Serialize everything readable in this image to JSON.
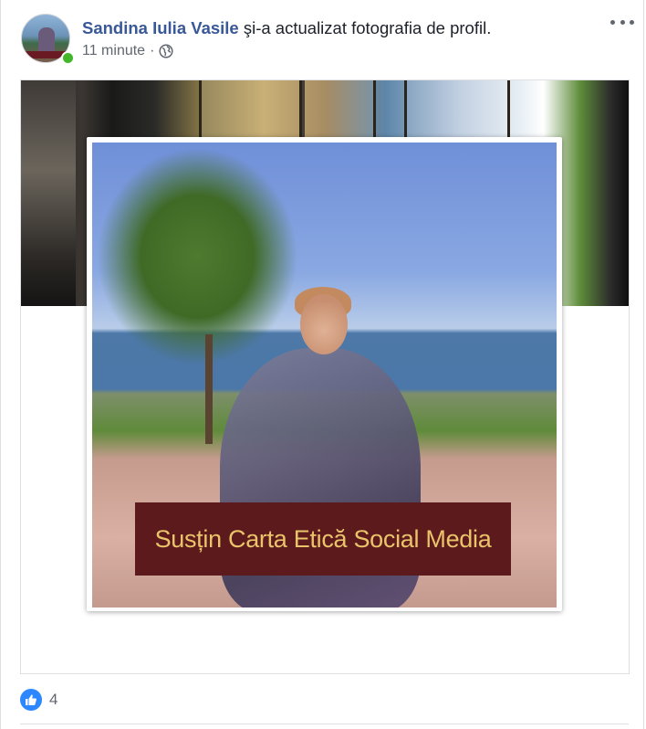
{
  "post": {
    "author": "Sandina Iulia Vasile",
    "action": " şi-a actualizat fotografia de profil.",
    "time": "11 minute",
    "separator": "·",
    "privacy_icon": "globe-icon",
    "more_icon": "more-options-icon"
  },
  "photo": {
    "caption": "Susțin Carta Etică Social Media"
  },
  "reactions": {
    "icon": "like-icon",
    "count": "4"
  },
  "colors": {
    "author_link": "#385898",
    "online": "#42b72a",
    "like": "#2d88ff",
    "caption_bg": "#5d1a1d",
    "caption_text": "#e9c46a"
  }
}
